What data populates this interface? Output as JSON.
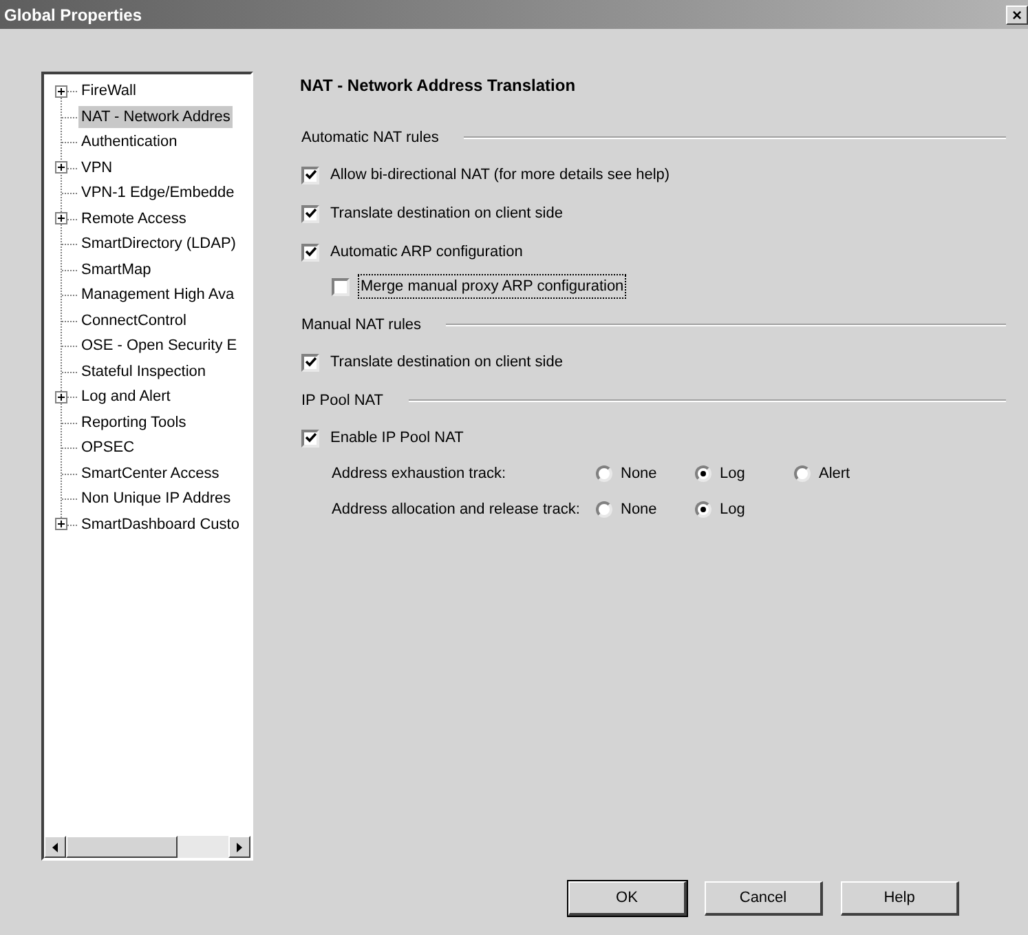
{
  "window": {
    "title": "Global Properties",
    "close": "×"
  },
  "tree": {
    "items": [
      {
        "label": "FireWall",
        "expandable": true,
        "selected": false
      },
      {
        "label": "NAT - Network Addres",
        "expandable": false,
        "selected": true
      },
      {
        "label": "Authentication",
        "expandable": false,
        "selected": false
      },
      {
        "label": "VPN",
        "expandable": true,
        "selected": false
      },
      {
        "label": "VPN-1 Edge/Embedde",
        "expandable": false,
        "selected": false
      },
      {
        "label": "Remote Access",
        "expandable": true,
        "selected": false
      },
      {
        "label": "SmartDirectory (LDAP)",
        "expandable": false,
        "selected": false
      },
      {
        "label": "SmartMap",
        "expandable": false,
        "selected": false
      },
      {
        "label": "Management High Ava",
        "expandable": false,
        "selected": false
      },
      {
        "label": "ConnectControl",
        "expandable": false,
        "selected": false
      },
      {
        "label": "OSE - Open Security E",
        "expandable": false,
        "selected": false
      },
      {
        "label": "Stateful Inspection",
        "expandable": false,
        "selected": false
      },
      {
        "label": "Log and Alert",
        "expandable": true,
        "selected": false
      },
      {
        "label": "Reporting Tools",
        "expandable": false,
        "selected": false
      },
      {
        "label": "OPSEC",
        "expandable": false,
        "selected": false
      },
      {
        "label": "SmartCenter Access",
        "expandable": false,
        "selected": false
      },
      {
        "label": "Non Unique IP Addres",
        "expandable": false,
        "selected": false
      },
      {
        "label": "SmartDashboard Custo",
        "expandable": true,
        "selected": false
      }
    ]
  },
  "page": {
    "title": "NAT - Network Address Translation",
    "sections": [
      {
        "title": "Automatic NAT rules",
        "rows": [
          {
            "kind": "checkbox",
            "label": "Allow bi-directional NAT  (for more details see help)",
            "checked": true,
            "indented": false,
            "focused": false
          },
          {
            "kind": "checkbox",
            "label": "Translate destination on client side",
            "checked": true,
            "indented": false,
            "focused": false
          },
          {
            "kind": "checkbox",
            "label": "Automatic ARP configuration",
            "checked": true,
            "indented": false,
            "focused": false
          },
          {
            "kind": "checkbox",
            "label": "Merge manual proxy ARP configuration",
            "checked": false,
            "indented": true,
            "focused": true
          }
        ]
      },
      {
        "title": "Manual NAT rules",
        "rows": [
          {
            "kind": "checkbox",
            "label": "Translate destination on client side",
            "checked": true,
            "indented": false,
            "focused": false
          }
        ]
      },
      {
        "title": "IP Pool NAT",
        "rows": [
          {
            "kind": "checkbox",
            "label": "Enable IP Pool NAT",
            "checked": true,
            "indented": false,
            "focused": false
          },
          {
            "kind": "radios",
            "label": "Address exhaustion track:",
            "options": [
              {
                "label": "None",
                "selected": false
              },
              {
                "label": "Log",
                "selected": true
              },
              {
                "label": "Alert",
                "selected": false
              }
            ]
          },
          {
            "kind": "radios",
            "label": "Address allocation and release track:",
            "options": [
              {
                "label": "None",
                "selected": false
              },
              {
                "label": "Log",
                "selected": true
              }
            ]
          }
        ]
      }
    ]
  },
  "buttons": [
    {
      "label": "OK",
      "default": true
    },
    {
      "label": "Cancel",
      "default": false
    },
    {
      "label": "Help",
      "default": false
    }
  ]
}
